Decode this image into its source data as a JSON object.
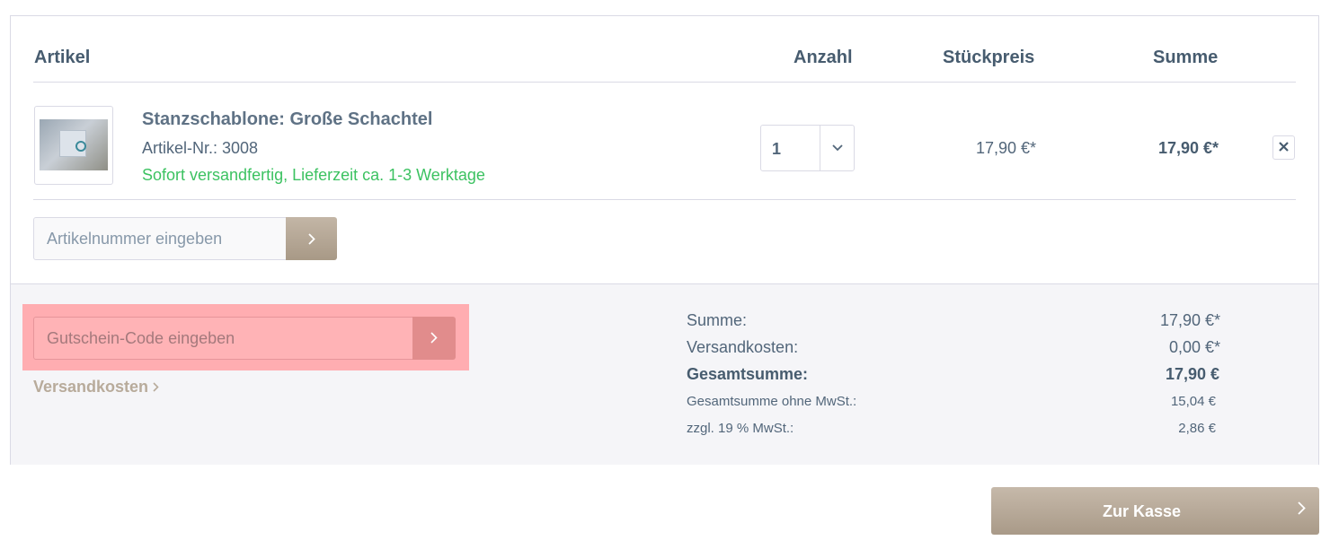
{
  "table": {
    "headers": {
      "article": "Artikel",
      "quantity": "Anzahl",
      "unit_price": "Stückpreis",
      "total": "Summe"
    }
  },
  "item": {
    "name": "Stanzschablone: Große Schachtel",
    "article_number": "Artikel-Nr.: 3008",
    "delivery": "Sofort versandfertig, Lieferzeit ca. 1-3 Werktage",
    "quantity": "1",
    "unit_price": "17,90 €*",
    "total": "17,90 €*",
    "remove_icon": "close-icon"
  },
  "add_article": {
    "placeholder": "Artikelnummer eingeben",
    "submit_icon": "chevron-right-icon"
  },
  "voucher": {
    "placeholder": "Gutschein-Code eingeben",
    "submit_icon": "chevron-right-icon",
    "highlight_color": "#ffadb1"
  },
  "shipping_link": "Versandkosten",
  "summary": [
    {
      "label": "Summe:",
      "value": "17,90 €*",
      "style": "normal"
    },
    {
      "label": "Versandkosten:",
      "value": "0,00 €*",
      "style": "normal"
    },
    {
      "label": "Gesamtsumme:",
      "value": "17,90 €",
      "style": "bold"
    },
    {
      "label": "Gesamtsumme ohne MwSt.:",
      "value": "15,04 €",
      "style": "small"
    },
    {
      "label": "zzgl. 19 % MwSt.:",
      "value": "2,86 €",
      "style": "small"
    }
  ],
  "checkout": {
    "label": "Zur Kasse",
    "icon": "chevron-right-icon"
  },
  "colors": {
    "accent": "#a99a88",
    "delivery_green": "#3cc261",
    "text": "#52667a"
  }
}
